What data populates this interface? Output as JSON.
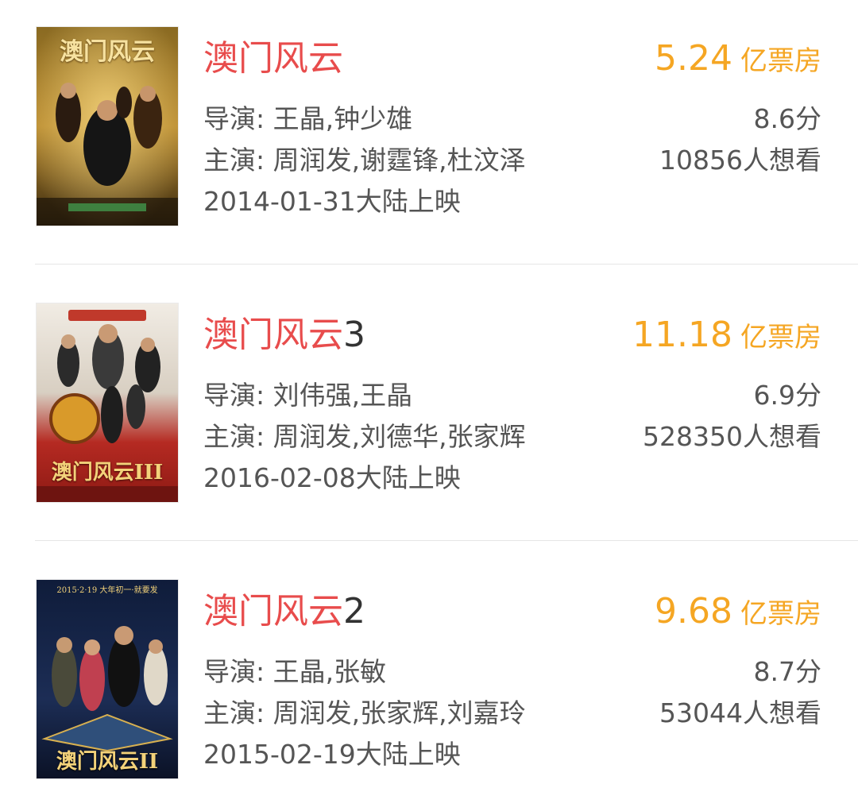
{
  "movies": [
    {
      "title": "澳门风云",
      "title_suffix": "",
      "box_office": "5.24",
      "box_office_unit": "亿票房",
      "director_label": "导演: ",
      "directors": "王晶,钟少雄",
      "cast_label": "主演: ",
      "cast": "周润发,谢霆锋,杜汶泽",
      "release": "2014-01-31大陆上映",
      "score": "8.6分",
      "want_to_see": "10856人想看",
      "poster_text": "澳门风云"
    },
    {
      "title": "澳门风云",
      "title_suffix": "3",
      "box_office": "11.18",
      "box_office_unit": "亿票房",
      "director_label": "导演: ",
      "directors": "刘伟强,王晶",
      "cast_label": "主演: ",
      "cast": "周润发,刘德华,张家辉",
      "release": "2016-02-08大陆上映",
      "score": "6.9分",
      "want_to_see": "528350人想看",
      "poster_text": "澳门风云III"
    },
    {
      "title": "澳门风云",
      "title_suffix": "2",
      "box_office": "9.68",
      "box_office_unit": "亿票房",
      "director_label": "导演: ",
      "directors": "王晶,张敏",
      "cast_label": "主演: ",
      "cast": "周润发,张家辉,刘嘉玲",
      "release": "2015-02-19大陆上映",
      "score": "8.7分",
      "want_to_see": "53044人想看",
      "poster_text": "澳门风云II",
      "poster_top_text": "2015·2·19 大年初一·就要发"
    }
  ],
  "colors": {
    "title": "#e84c4c",
    "box_office": "#f5a623",
    "meta": "#555555",
    "divider": "#e6e6e6"
  }
}
